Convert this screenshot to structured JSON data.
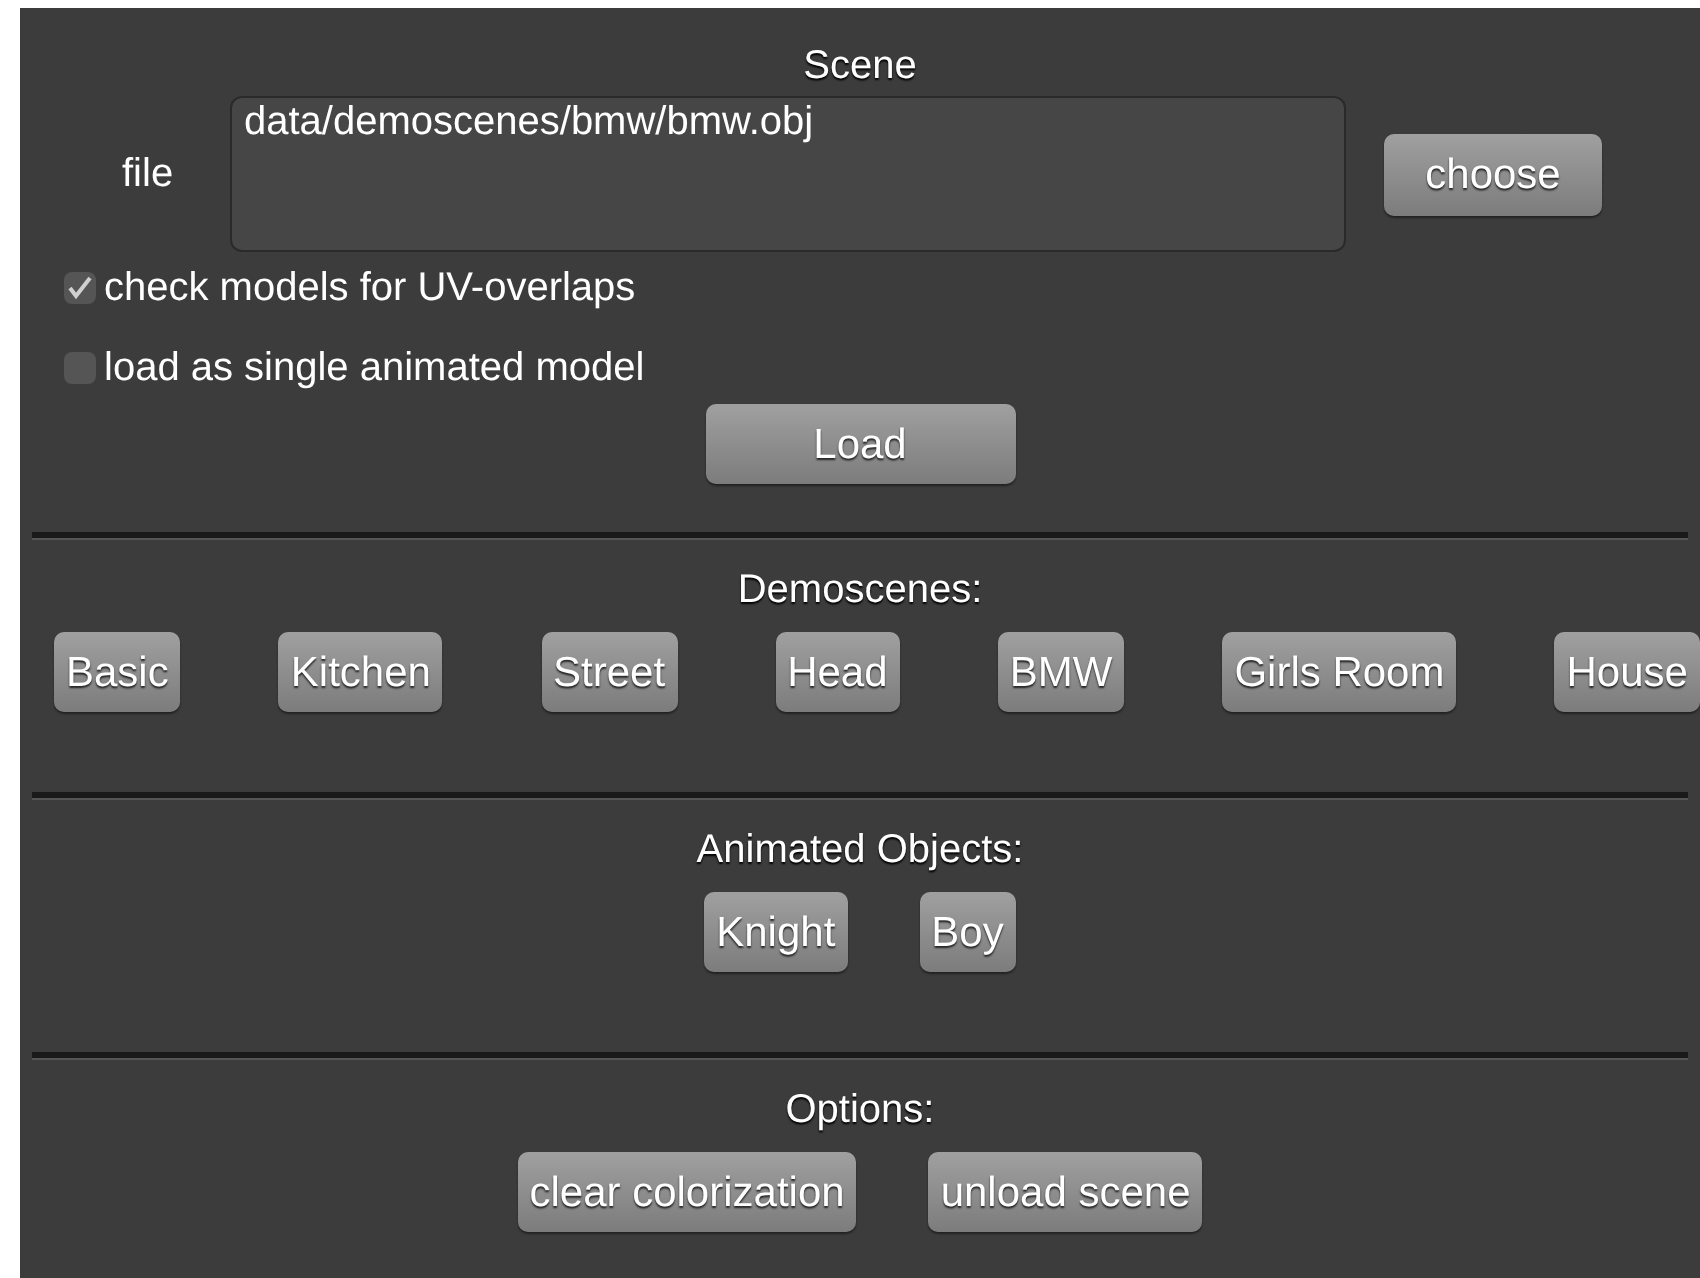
{
  "scene": {
    "title": "Scene",
    "file_label": "file",
    "file_value": "data/demoscenes/bmw/bmw.obj",
    "choose_button": "choose",
    "options": [
      {
        "label": "check models for UV-overlaps",
        "checked": true
      },
      {
        "label": "load as single animated model",
        "checked": false
      }
    ],
    "load_button": "Load"
  },
  "demoscenes": {
    "title": "Demoscenes:",
    "buttons": [
      "Basic",
      "Kitchen",
      "Street",
      "Head",
      "BMW",
      "Girls Room",
      "House"
    ]
  },
  "animated_objects": {
    "title": "Animated Objects:",
    "buttons": [
      "Knight",
      "Boy"
    ]
  },
  "options": {
    "title": "Options:",
    "buttons": [
      "clear colorization",
      "unload scene"
    ]
  }
}
